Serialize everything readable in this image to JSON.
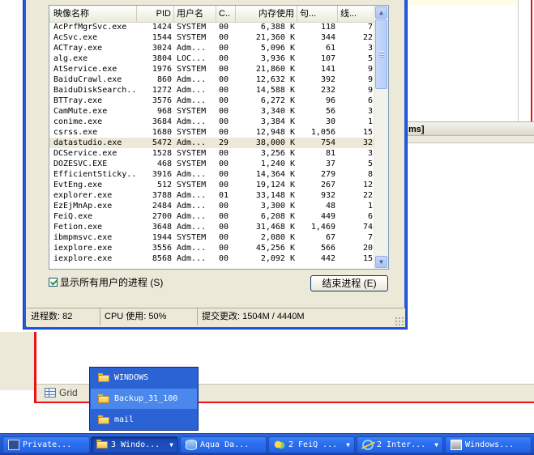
{
  "background": {
    "splitter_label": "ms]",
    "grid_tab_label": "Grid"
  },
  "task_manager": {
    "columns": [
      {
        "label": "映像名称"
      },
      {
        "label": "PID"
      },
      {
        "label": "用户名"
      },
      {
        "label": "C.."
      },
      {
        "label": "内存使用"
      },
      {
        "label": "句..."
      },
      {
        "label": "线..."
      }
    ],
    "processes": [
      [
        "AcPrfMgrSvc.exe",
        "1424",
        "SYSTEM",
        "00",
        "6,388 K",
        "118",
        "7"
      ],
      [
        "AcSvc.exe",
        "1544",
        "SYSTEM",
        "00",
        "21,360 K",
        "344",
        "22"
      ],
      [
        "ACTray.exe",
        "3024",
        "Adm...",
        "00",
        "5,096 K",
        "61",
        "3"
      ],
      [
        "alg.exe",
        "3804",
        "LOC...",
        "00",
        "3,936 K",
        "107",
        "5"
      ],
      [
        "AtService.exe",
        "1976",
        "SYSTEM",
        "00",
        "21,860 K",
        "141",
        "9"
      ],
      [
        "BaiduCrawl.exe",
        "860",
        "Adm...",
        "00",
        "12,632 K",
        "392",
        "9"
      ],
      [
        "BaiduDiskSearch...",
        "1272",
        "Adm...",
        "00",
        "14,588 K",
        "232",
        "9"
      ],
      [
        "BTTray.exe",
        "3576",
        "Adm...",
        "00",
        "6,272 K",
        "96",
        "6"
      ],
      [
        "CamMute.exe",
        "968",
        "SYSTEM",
        "00",
        "3,340 K",
        "56",
        "3"
      ],
      [
        "conime.exe",
        "3684",
        "Adm...",
        "00",
        "3,384 K",
        "30",
        "1"
      ],
      [
        "csrss.exe",
        "1680",
        "SYSTEM",
        "00",
        "12,948 K",
        "1,056",
        "15"
      ],
      [
        "datastudio.exe",
        "5472",
        "Adm...",
        "29",
        "38,000 K",
        "754",
        "32"
      ],
      [
        "DCService.exe",
        "1528",
        "SYSTEM",
        "00",
        "3,256 K",
        "81",
        "3"
      ],
      [
        "DOZESVC.EXE",
        "468",
        "SYSTEM",
        "00",
        "1,240 K",
        "37",
        "5"
      ],
      [
        "EfficientSticky...",
        "3916",
        "Adm...",
        "00",
        "14,364 K",
        "279",
        "8"
      ],
      [
        "EvtEng.exe",
        "512",
        "SYSTEM",
        "00",
        "19,124 K",
        "267",
        "12"
      ],
      [
        "explorer.exe",
        "3788",
        "Adm...",
        "01",
        "33,148 K",
        "932",
        "22"
      ],
      [
        "EzEjMnAp.exe",
        "2484",
        "Adm...",
        "00",
        "3,300 K",
        "48",
        "1"
      ],
      [
        "FeiQ.exe",
        "2700",
        "Adm...",
        "00",
        "6,208 K",
        "449",
        "6"
      ],
      [
        "Fetion.exe",
        "3648",
        "Adm...",
        "00",
        "31,468 K",
        "1,469",
        "74"
      ],
      [
        "ibmpmsvc.exe",
        "1944",
        "SYSTEM",
        "00",
        "2,080 K",
        "67",
        "7"
      ],
      [
        "iexplore.exe",
        "3556",
        "Adm...",
        "00",
        "45,256 K",
        "566",
        "20"
      ],
      [
        "iexplore.exe",
        "8568",
        "Adm...",
        "00",
        "2,092 K",
        "442",
        "15"
      ]
    ],
    "show_all_users_label": "显示所有用户的进程 (S)",
    "end_process_label": "结束进程 (E)",
    "status": {
      "processes": "进程数: 82",
      "cpu": "CPU 使用: 50%",
      "commit": "提交更改: 1504M / 4440M"
    }
  },
  "jump_list": {
    "items": [
      "WINDOWS",
      "Backup_31_100",
      "mail"
    ]
  },
  "taskbar": {
    "buttons": [
      "Private...",
      "3 Windo...",
      "Aqua Da...",
      "2 FeiQ ...",
      "2 Inter...",
      "Windows..."
    ]
  }
}
